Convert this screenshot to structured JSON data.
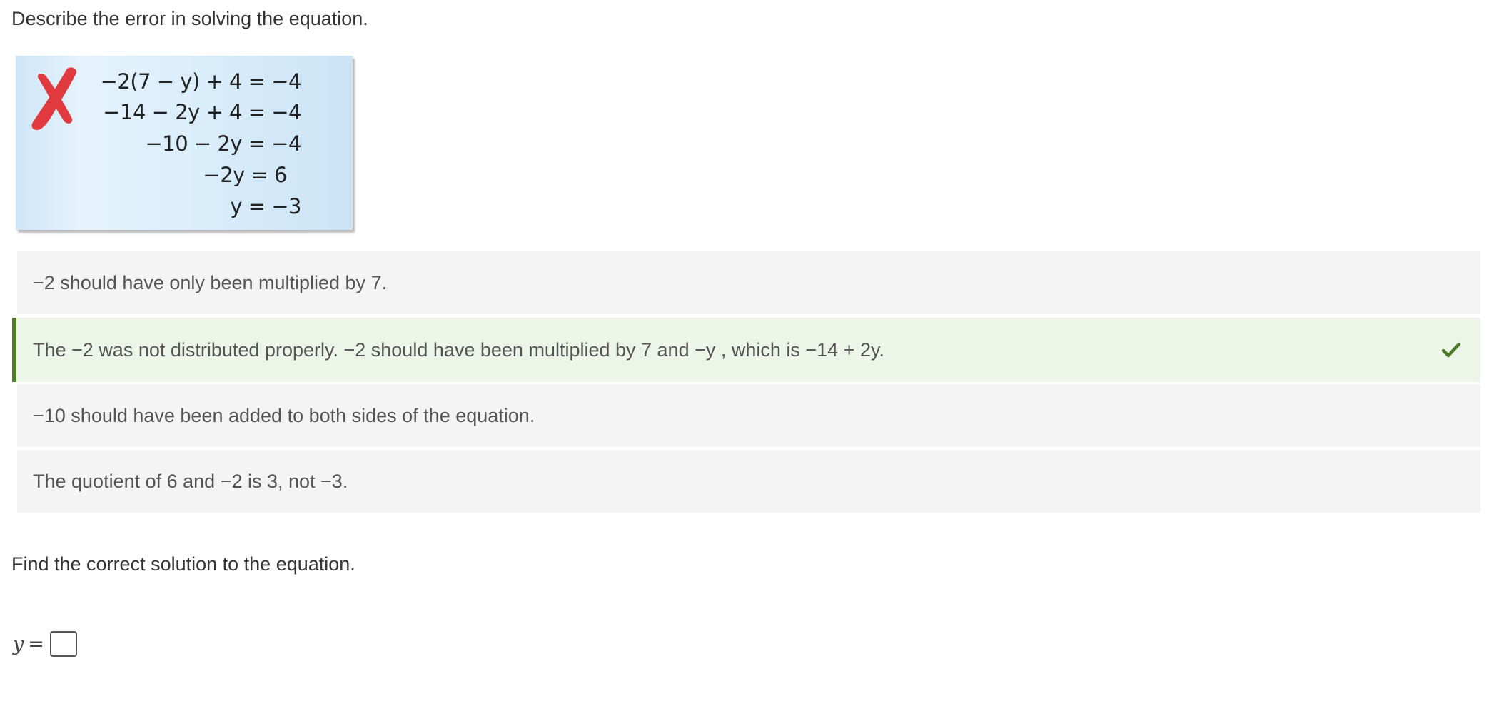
{
  "prompts": {
    "describe_error": "Describe the error in solving the equation.",
    "find_solution": "Find the correct solution to the equation."
  },
  "figure": {
    "lines": [
      "−2(7 − y) + 4 = −4",
      "−14 − 2y + 4 = −4",
      "−10 − 2y = −4",
      "−2y = 6",
      "y = −3"
    ],
    "mark": "red-x-icon",
    "mark_color": "#e03a3e"
  },
  "choices": [
    {
      "text": "−2 should have only been multiplied by 7.",
      "state": "unselected"
    },
    {
      "text": "The −2 was not distributed properly.  −2 should have been multiplied by 7 and −y , which is −14 + 2y.",
      "state": "selected-correct"
    },
    {
      "text": "−10 should have been added to both sides of the equation.",
      "state": "unselected"
    },
    {
      "text": "The quotient of 6 and −2 is 3, not −3.",
      "state": "unselected"
    }
  ],
  "answer": {
    "variable": "y",
    "equals": "=",
    "value": ""
  },
  "colors": {
    "correct_accent": "#4e7a2b",
    "correct_bg": "#edf5e8",
    "choice_bg": "#f4f4f4",
    "check_color": "#4e7a2b"
  }
}
